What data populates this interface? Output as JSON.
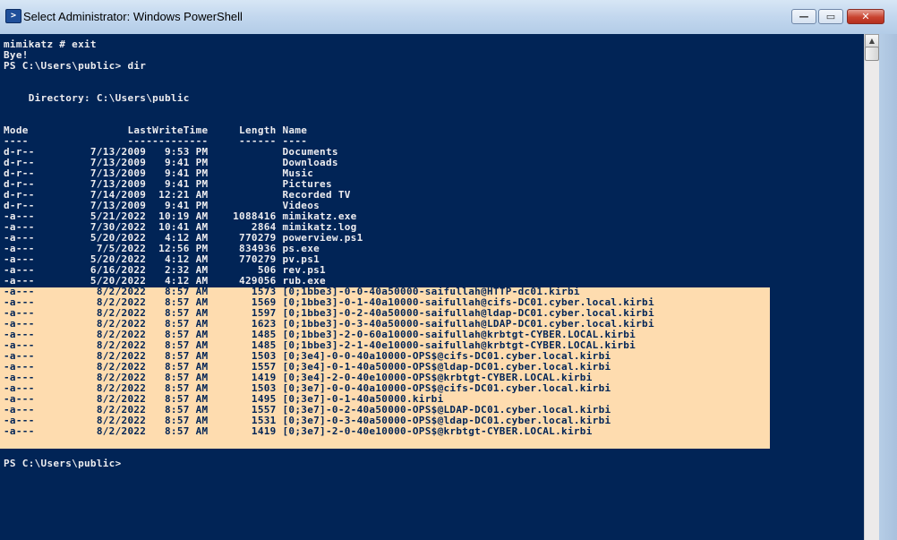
{
  "window": {
    "title": "Select Administrator: Windows PowerShell",
    "minimize_glyph": "—",
    "maximize_glyph": "▭",
    "close_glyph": "✕",
    "icon_glyph": ">"
  },
  "colors": {
    "console_bg": "#012456",
    "console_fg": "#eeedf0",
    "selection_bg": "#fedcaf"
  },
  "console": {
    "lines": [
      "mimikatz # exit",
      "Bye!",
      "PS C:\\Users\\public> dir",
      "",
      "",
      "    Directory: C:\\Users\\public",
      "",
      "",
      "Mode                LastWriteTime     Length Name",
      "----                -------------     ------ ----",
      "d-r--         7/13/2009   9:53 PM            Documents",
      "d-r--         7/13/2009   9:41 PM            Downloads",
      "d-r--         7/13/2009   9:41 PM            Music",
      "d-r--         7/13/2009   9:41 PM            Pictures",
      "d-r--         7/14/2009  12:21 AM            Recorded TV",
      "d-r--         7/13/2009   9:41 PM            Videos",
      "-a---         5/21/2022  10:19 AM    1088416 mimikatz.exe",
      "-a---         7/30/2022  10:41 AM       2864 mimikatz.log",
      "-a---         5/20/2022   4:12 AM     770279 powerview.ps1",
      "-a---          7/5/2022  12:56 PM     834936 ps.exe",
      "-a---         5/20/2022   4:12 AM     770279 pv.ps1",
      "-a---         6/16/2022   2:32 AM        506 rev.ps1",
      "-a---         5/20/2022   4:12 AM     429056 rub.exe",
      "-a---          8/2/2022   8:57 AM       1573 [0;1bbe3]-0-0-40a50000-saifullah@HTTP-dc01.kirbi",
      "-a---          8/2/2022   8:57 AM       1569 [0;1bbe3]-0-1-40a10000-saifullah@cifs-DC01.cyber.local.kirbi",
      "-a---          8/2/2022   8:57 AM       1597 [0;1bbe3]-0-2-40a50000-saifullah@ldap-DC01.cyber.local.kirbi",
      "-a---          8/2/2022   8:57 AM       1623 [0;1bbe3]-0-3-40a50000-saifullah@LDAP-DC01.cyber.local.kirbi",
      "-a---          8/2/2022   8:57 AM       1485 [0;1bbe3]-2-0-60a10000-saifullah@krbtgt-CYBER.LOCAL.kirbi",
      "-a---          8/2/2022   8:57 AM       1485 [0;1bbe3]-2-1-40e10000-saifullah@krbtgt-CYBER.LOCAL.kirbi",
      "-a---          8/2/2022   8:57 AM       1503 [0;3e4]-0-0-40a10000-OPS$@cifs-DC01.cyber.local.kirbi",
      "-a---          8/2/2022   8:57 AM       1557 [0;3e4]-0-1-40a50000-OPS$@ldap-DC01.cyber.local.kirbi",
      "-a---          8/2/2022   8:57 AM       1419 [0;3e4]-2-0-40e10000-OPS$@krbtgt-CYBER.LOCAL.kirbi",
      "-a---          8/2/2022   8:57 AM       1503 [0;3e7]-0-0-40a10000-OPS$@cifs-DC01.cyber.local.kirbi",
      "-a---          8/2/2022   8:57 AM       1495 [0;3e7]-0-1-40a50000.kirbi",
      "-a---          8/2/2022   8:57 AM       1557 [0;3e7]-0-2-40a50000-OPS$@LDAP-DC01.cyber.local.kirbi",
      "-a---          8/2/2022   8:57 AM       1531 [0;3e7]-0-3-40a50000-OPS$@ldap-DC01.cyber.local.kirbi",
      "-a---          8/2/2022   8:57 AM       1419 [0;3e7]-2-0-40e10000-OPS$@krbtgt-CYBER.LOCAL.kirbi",
      "",
      "",
      "PS C:\\Users\\public>"
    ],
    "highlighted_range": [
      23,
      36
    ]
  }
}
